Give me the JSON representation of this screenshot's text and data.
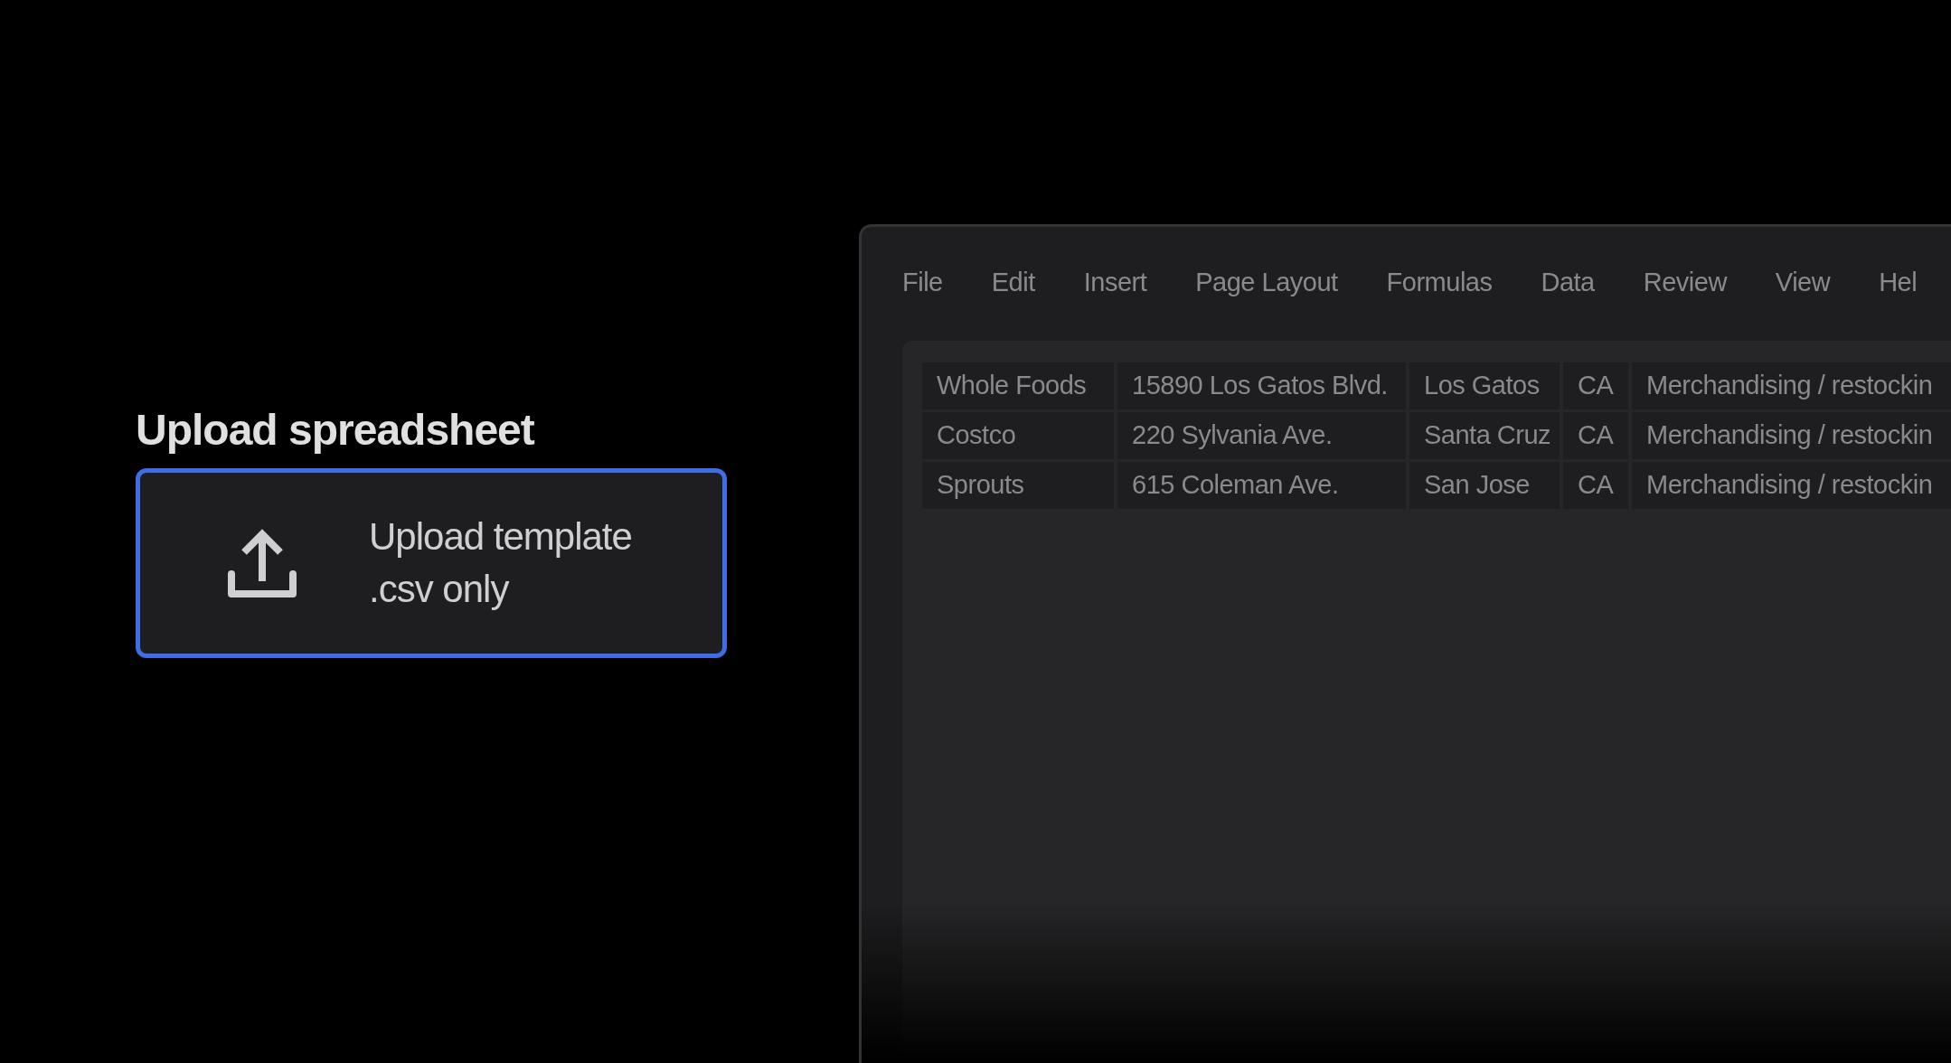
{
  "upload": {
    "title": "Upload spreadsheet",
    "selected": true,
    "lines": [
      "Upload template",
      ".csv only"
    ]
  },
  "window": {
    "menu": [
      "File",
      "Edit",
      "Insert",
      "Page Layout",
      "Formulas",
      "Data",
      "Review",
      "View",
      "Hel"
    ],
    "rows": [
      [
        "Whole Foods",
        "15890 Los Gatos Blvd.",
        "Los Gatos",
        "CA",
        "Merchandising / restockin"
      ],
      [
        "Costco",
        "220 Sylvania Ave.",
        "Santa Cruz",
        "CA",
        "Merchandising / restockin"
      ],
      [
        "Sprouts",
        "615 Coleman Ave.",
        "San Jose",
        "CA",
        "Merchandising / restockin"
      ]
    ]
  }
}
